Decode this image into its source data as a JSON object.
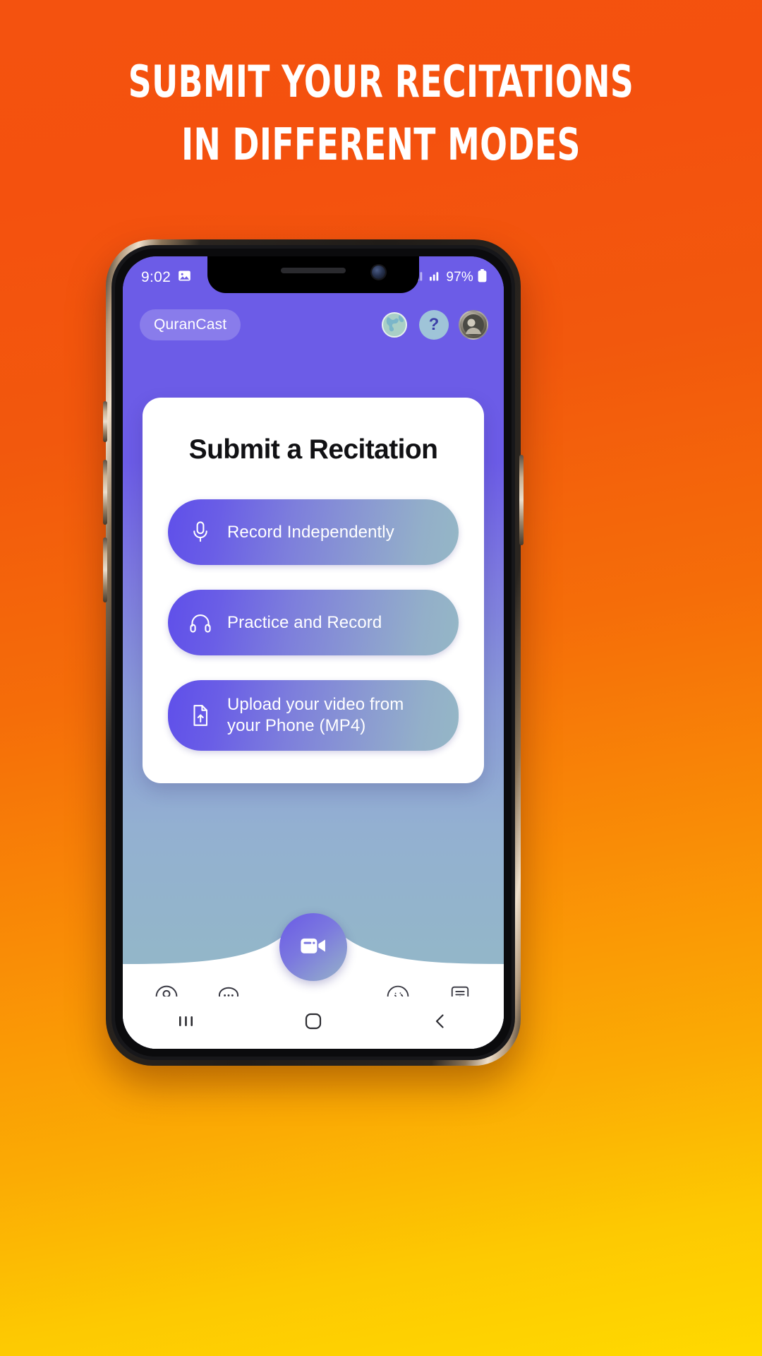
{
  "promo": {
    "line1": "SUBMIT YOUR RECITATIONS",
    "line2": "IN DIFFERENT MODES",
    "background_start": "#f4520f",
    "background_end": "#ffd900",
    "text_color": "#ffffff"
  },
  "phone": {
    "status_bar": {
      "time": "9:02",
      "image_icon": "image-icon",
      "signal_icon": "signal-bars-icon",
      "wifi_icon": "signal-bars-icon",
      "battery_percent": "97%",
      "battery_icon": "battery-icon"
    },
    "app_header": {
      "brand": "QuranCast",
      "icons": [
        {
          "name": "globe-icon",
          "label": "Language"
        },
        {
          "name": "help-icon",
          "label": "?"
        },
        {
          "name": "avatar-icon",
          "label": "Profile"
        }
      ]
    },
    "card": {
      "title": "Submit a Recitation",
      "options": [
        {
          "icon": "microphone-icon",
          "label": "Record Independently"
        },
        {
          "icon": "headphones-icon",
          "label": "Practice and Record"
        },
        {
          "icon": "file-upload-icon",
          "label": "Upload your video from your Phone (MP4)"
        }
      ],
      "accent_start": "#5f4fea",
      "accent_end": "#95b7c6"
    },
    "bottom_nav": {
      "items": [
        {
          "name": "profile-icon"
        },
        {
          "name": "chat-icon"
        },
        {
          "name": "arabic-badge-icon"
        },
        {
          "name": "certificate-icon"
        }
      ],
      "fab": {
        "name": "video-camera-icon"
      }
    },
    "system_nav": {
      "recents": "recents-icon",
      "home": "home-icon",
      "back": "back-icon"
    }
  }
}
